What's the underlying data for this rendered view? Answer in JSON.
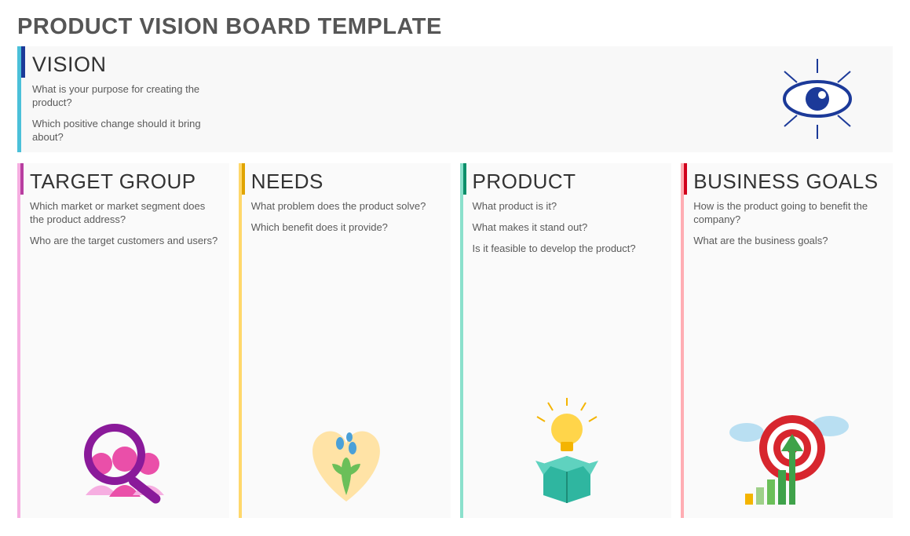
{
  "title": "PRODUCT VISION BOARD TEMPLATE",
  "vision": {
    "title": "VISION",
    "p1": "What is your purpose for creating the product?",
    "p2": "Which positive change should it bring about?"
  },
  "target": {
    "title": "TARGET GROUP",
    "p1": "Which market or market segment does the product address?",
    "p2": "Who are the target customers and users?"
  },
  "needs": {
    "title": "NEEDS",
    "p1": "What problem does the product solve?",
    "p2": "Which benefit does it provide?"
  },
  "product": {
    "title": "PRODUCT",
    "p1": "What product is it?",
    "p2": "What makes it stand out?",
    "p3": "Is it feasible to develop the product?"
  },
  "goals": {
    "title": "BUSINESS GOALS",
    "p1": "How is the product going to benefit the company?",
    "p2": "What are the business goals?"
  }
}
